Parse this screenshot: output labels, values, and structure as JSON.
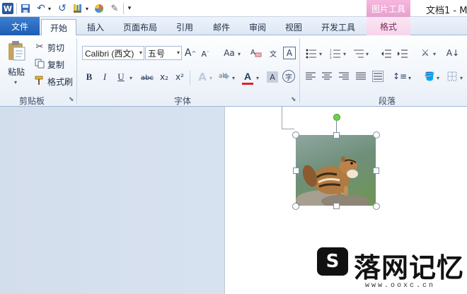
{
  "titlebar": {
    "app_icon": "W",
    "tool_banner": "图片工具",
    "document_title": "文档1 - M"
  },
  "tabs": {
    "file": "文件",
    "home": "开始",
    "insert": "插入",
    "page_layout": "页面布局",
    "references": "引用",
    "mailings": "邮件",
    "review": "审阅",
    "view": "视图",
    "developer": "开发工具",
    "format": "格式"
  },
  "clipboard": {
    "paste": "粘贴",
    "cut": "剪切",
    "copy": "复制",
    "format_painter": "格式刷",
    "group_label": "剪贴板"
  },
  "font": {
    "font_name": "Calibri (西文)",
    "font_size": "五号",
    "group_label": "字体",
    "change_case": "Aa",
    "bold": "B",
    "italic": "I",
    "underline": "U",
    "strikethrough": "abc",
    "subscript": "x₂",
    "superscript": "x²",
    "font_color": "A",
    "grow": "A",
    "shrink": "A"
  },
  "paragraph": {
    "group_label": "段落"
  },
  "watermark": {
    "logo_char": "S",
    "text": "落网记忆",
    "url": "www.ooxc.cn"
  },
  "colors": {
    "file_tab": "#2b6bc4",
    "picture_tools": "#e6a0cf",
    "rotate_handle": "#6fd04a",
    "font_color_bar": "#d7262a"
  }
}
